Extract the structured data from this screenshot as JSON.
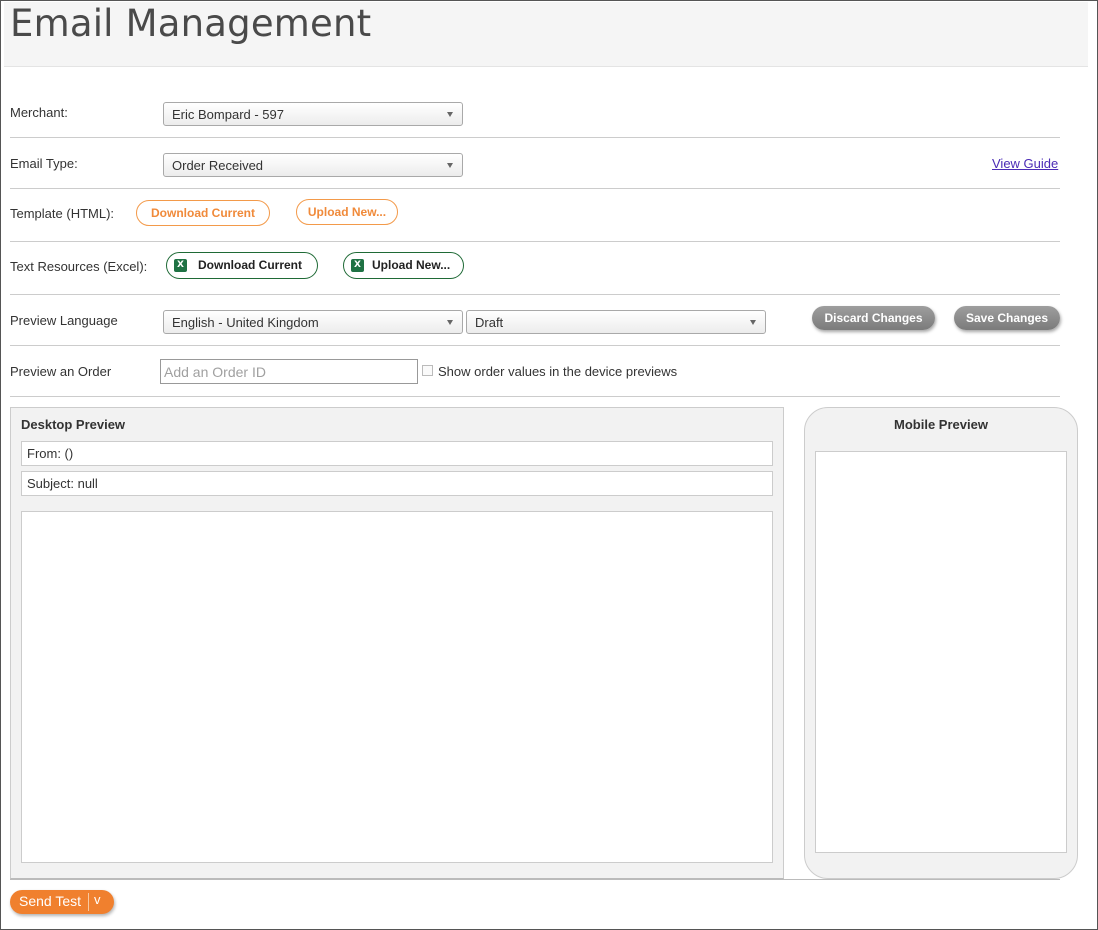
{
  "page": {
    "title": "Email Management"
  },
  "merchant": {
    "label": "Merchant:",
    "value": "Eric Bompard - 597"
  },
  "email_type": {
    "label": "Email Type:",
    "value": "Order Received",
    "guide_link": "View Guide"
  },
  "template": {
    "label": "Template (HTML):",
    "download": "Download Current",
    "upload": "Upload New..."
  },
  "text_resources": {
    "label": "Text Resources (Excel):",
    "download": "Download Current",
    "upload": "Upload New...",
    "icon": "excel-icon"
  },
  "preview_language": {
    "label": "Preview Language",
    "language": "English - United Kingdom",
    "status": "Draft",
    "discard": "Discard Changes",
    "save": "Save Changes"
  },
  "preview_order": {
    "label": "Preview an Order",
    "placeholder": "Add an Order ID",
    "checkbox_label": "Show order values in the device previews",
    "checked": false
  },
  "desktop_preview": {
    "title": "Desktop Preview",
    "from": "From: ()",
    "subject": "Subject: null"
  },
  "mobile_preview": {
    "title": "Mobile Preview"
  },
  "send_test": {
    "label": "Send Test",
    "caret": "v"
  },
  "colors": {
    "accent_orange": "#f0802e",
    "excel_green": "#1f7244",
    "link": "#4b2bb5"
  }
}
